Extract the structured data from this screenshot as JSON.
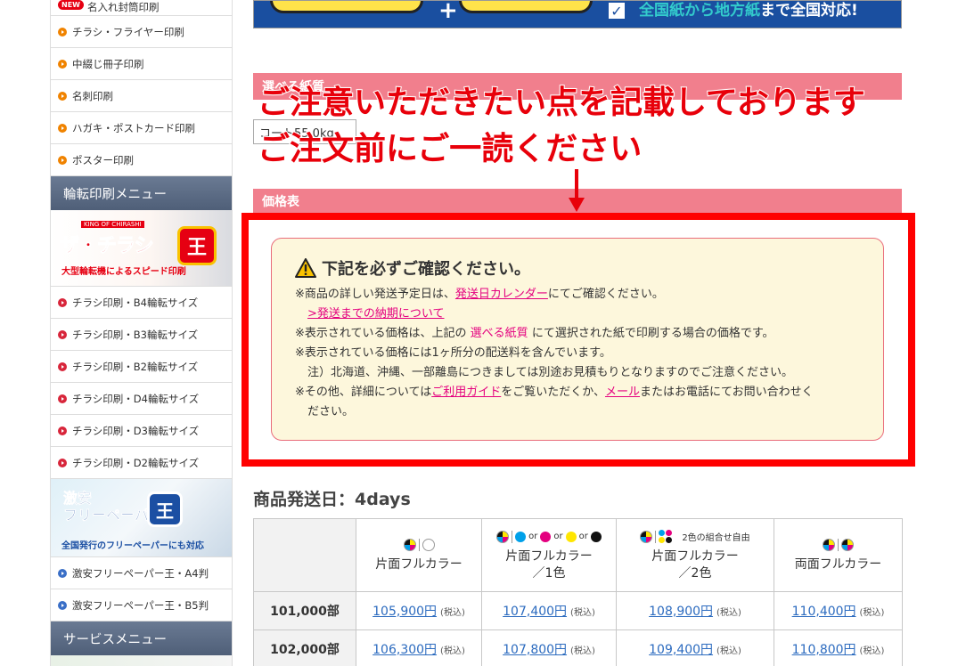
{
  "sidebar": {
    "partial_item": {
      "badge": "NEW",
      "label": "名入れ封筒印刷"
    },
    "items_top": [
      {
        "label": "チラシ・フライヤー印刷"
      },
      {
        "label": "中綴じ冊子印刷"
      },
      {
        "label": "名刺印刷"
      },
      {
        "label": "ハガキ・ポストカード印刷"
      },
      {
        "label": "ポスター印刷"
      }
    ],
    "rotary_header": "輪転印刷メニュー",
    "chirashi_banner": {
      "king": "KING OF CHIRASHI",
      "title": "ザ・チラシ",
      "emblem": "王",
      "subtitle": "大型輪転機によるスピード印刷"
    },
    "rotary_items": [
      {
        "label": "チラシ印刷・B4輪転サイズ"
      },
      {
        "label": "チラシ印刷・B3輪転サイズ"
      },
      {
        "label": "チラシ印刷・B2輪転サイズ"
      },
      {
        "label": "チラシ印刷・D4輪転サイズ"
      },
      {
        "label": "チラシ印刷・D3輪転サイズ"
      },
      {
        "label": "チラシ印刷・D2輪転サイズ"
      }
    ],
    "free_banner": {
      "title_line1": "激安",
      "title_line2": "フリーペーパー",
      "emblem": "王",
      "subtitle": "全国発行のフリーペーパーにも対応"
    },
    "free_items": [
      {
        "label": "激安フリーペーパー王・A4判"
      },
      {
        "label": "激安フリーペーパー王・B5判"
      }
    ],
    "service_header": "サービスメニュー"
  },
  "top_banner": {
    "text_cyan": "全国紙から地方紙",
    "text_white": "まで全国対応!"
  },
  "paper_section": {
    "header": "選べる紙質",
    "select_value": "コート55.0kg"
  },
  "annotation": {
    "line1": "ご注意いただきたい点を記載しております",
    "line2": "ご注文前にご一読ください"
  },
  "price_section": {
    "header": "価格表"
  },
  "notice": {
    "title": "下記を必ずご確認ください。",
    "l1_pre": "※商品の詳しい発送予定日は、",
    "l1_link": "発送日カレンダー",
    "l1_post": "にてご確認ください。",
    "l2_link": ">発送までの納期について",
    "l3_pre": "※表示されている価格は、上記の",
    "l3_red": "選べる紙質",
    "l3_post": "にて選択された紙で印刷する場合の価格です。",
    "l4": "※表示されている価格には1ヶ所分の配送料を含んでいます。",
    "l5": "注）北海道、沖縄、一部離島につきましては別途お見積もりとなりますのでご注意ください。",
    "l6_pre": "※その他、詳細については",
    "l6_link1": "ご利用ガイド",
    "l6_mid": "をご覧いただくか、",
    "l6_link2": "メール",
    "l6_post": "またはお電話にてお問い合わせく",
    "l7": "ださい。"
  },
  "shipping": {
    "heading": "商品発送日：4days"
  },
  "table": {
    "columns": [
      {
        "line1": "片面フルカラー",
        "line2": ""
      },
      {
        "line1": "片面フルカラー",
        "line2": "／1色",
        "or": "or"
      },
      {
        "line1": "片面フルカラー",
        "line2": "／2色",
        "combo": "2色の組合せ自由"
      },
      {
        "line1": "両面フルカラー",
        "line2": ""
      }
    ],
    "rows": [
      {
        "qty": "101,000部",
        "prices": [
          "105,900円",
          "107,400円",
          "108,900円",
          "110,400円"
        ],
        "tax": "(税込)"
      },
      {
        "qty": "102,000部",
        "prices": [
          "106,300円",
          "107,800円",
          "109,400円",
          "110,800円"
        ],
        "tax": "(税込)"
      }
    ]
  },
  "colors": {
    "accent_pink": "#f17f8d",
    "annotation_red": "#e8000a",
    "link_blue": "#2c6bbf",
    "link_magenta": "#e4007f"
  }
}
